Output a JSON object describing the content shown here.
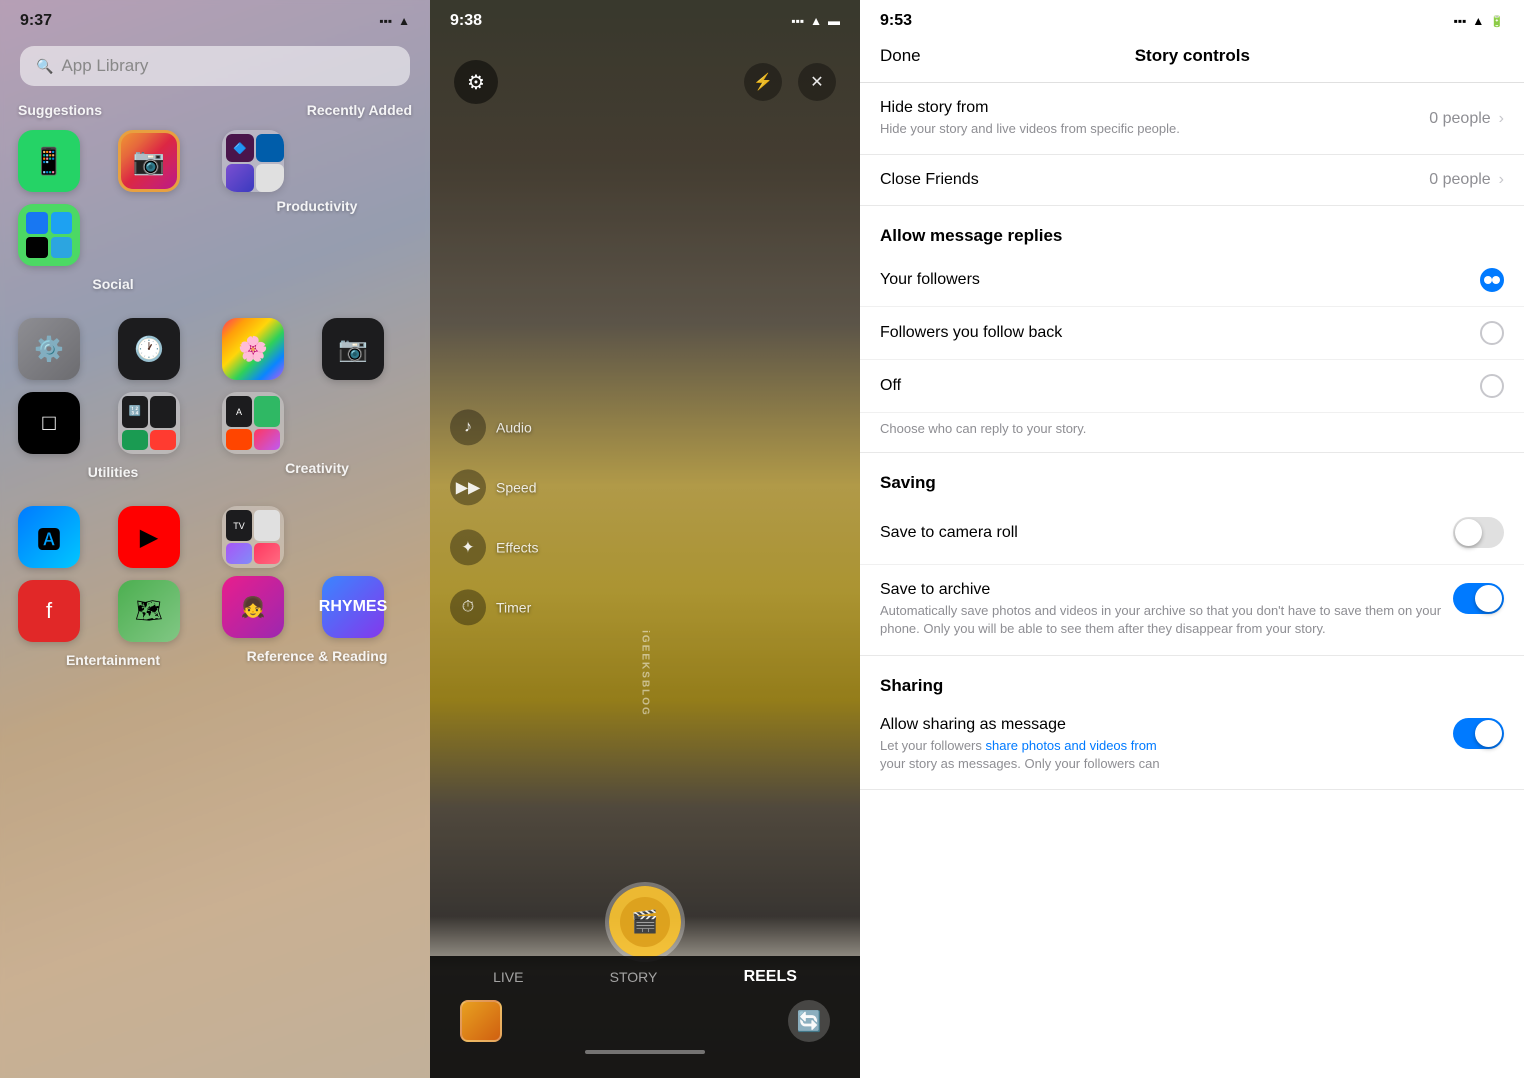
{
  "panel1": {
    "status_time": "9:37",
    "search_placeholder": "App Library",
    "sections": [
      {
        "label": "Suggestions"
      },
      {
        "label": "Recently Added"
      }
    ],
    "categories": [
      {
        "label": "Social"
      },
      {
        "label": "Productivity"
      },
      {
        "label": "Utilities"
      },
      {
        "label": "Creativity"
      },
      {
        "label": "Entertainment"
      },
      {
        "label": "Reference & Reading"
      }
    ]
  },
  "panel2": {
    "status_time": "9:38",
    "controls": [
      {
        "icon": "♪",
        "label": "Audio"
      },
      {
        "icon": "⏩",
        "label": "Speed"
      },
      {
        "icon": "✨",
        "label": "Effects"
      },
      {
        "icon": "⏱",
        "label": "Timer"
      }
    ],
    "modes": [
      {
        "label": "LIVE"
      },
      {
        "label": "STORY"
      },
      {
        "label": "REELS"
      }
    ],
    "active_mode": "REELS",
    "watermark": "iGEEKSBLOG"
  },
  "panel3": {
    "status_time": "9:53",
    "header": {
      "done_label": "Done",
      "title": "Story controls"
    },
    "hide_story": {
      "label": "Hide story from",
      "subtitle": "Hide your story and live videos from specific people.",
      "count": "0 people"
    },
    "close_friends": {
      "label": "Close Friends",
      "count": "0 people"
    },
    "allow_replies": {
      "section_title": "Allow message replies",
      "options": [
        {
          "label": "Your followers",
          "selected": true
        },
        {
          "label": "Followers you follow back",
          "selected": false
        },
        {
          "label": "Off",
          "selected": false
        }
      ],
      "helper_text": "Choose who can reply to your story."
    },
    "saving": {
      "section_title": "Saving",
      "save_camera_roll": {
        "label": "Save to camera roll",
        "enabled": false
      },
      "save_archive": {
        "label": "Save to archive",
        "enabled": true,
        "subtitle": "Automatically save photos and videos in your archive so that you don't have to save them on your phone. Only you will be able to see them after they disappear from your story."
      }
    },
    "sharing": {
      "section_title": "Sharing",
      "allow_message": {
        "label": "Allow sharing as message",
        "enabled": true,
        "subtitle": "Let your followers share photos and videos from your story as messages. Only your followers can"
      }
    }
  }
}
